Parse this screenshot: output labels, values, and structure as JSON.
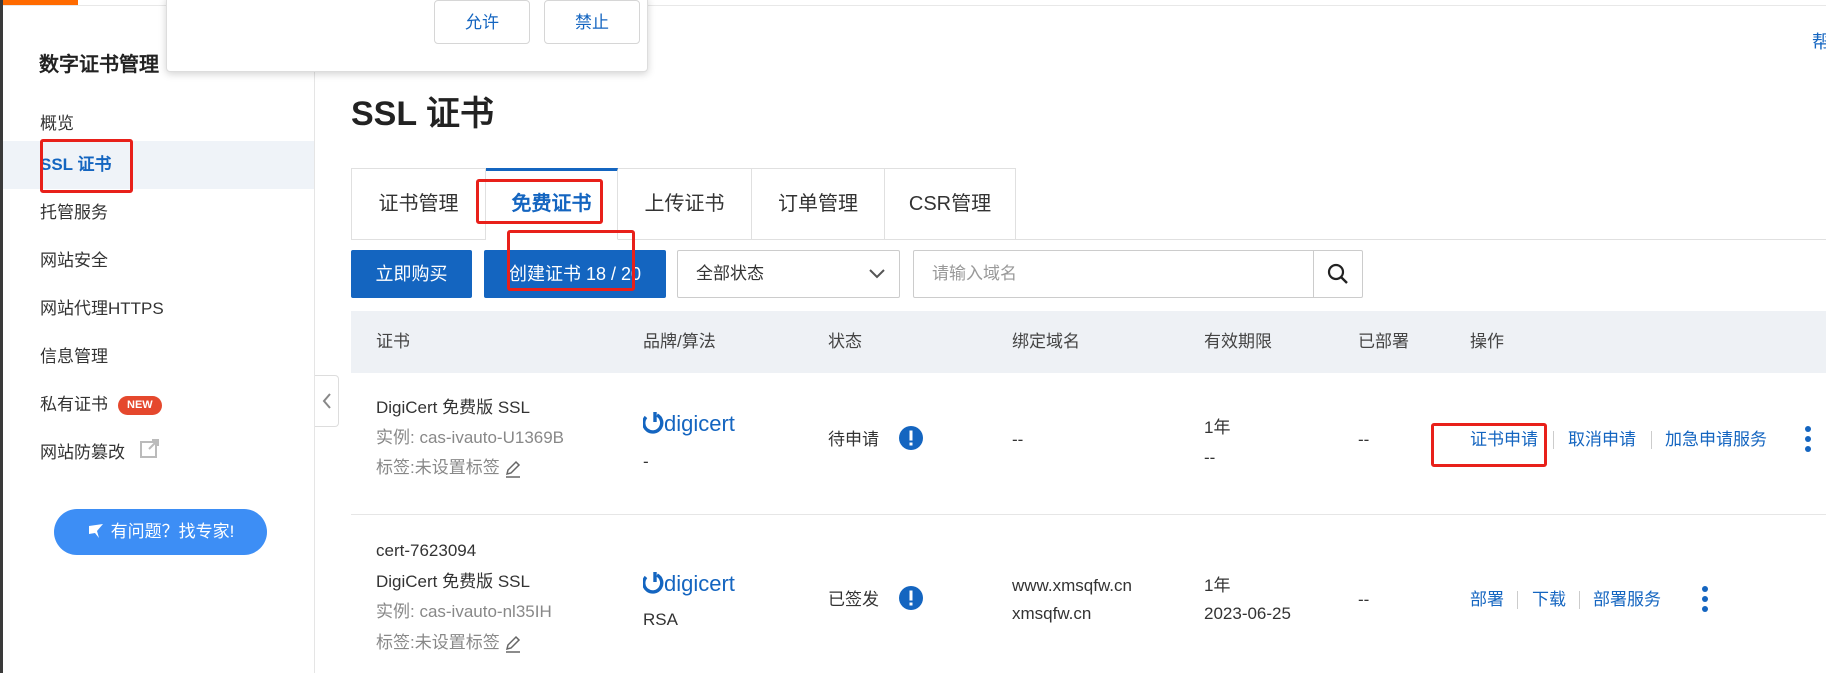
{
  "popup": {
    "allow_label": "允许",
    "deny_label": "禁止"
  },
  "help_corner": "帮",
  "sidebar": {
    "title": "数字证书管理",
    "items": [
      {
        "label": "概览"
      },
      {
        "label": "SSL 证书"
      },
      {
        "label": "托管服务"
      },
      {
        "label": "网站安全"
      },
      {
        "label": "网站代理HTTPS"
      },
      {
        "label": "信息管理"
      },
      {
        "label": "私有证书",
        "badge": "NEW"
      },
      {
        "label": "网站防篡改"
      }
    ],
    "help_button": "有问题？找专家!"
  },
  "page_title": "SSL 证书",
  "tabs": [
    {
      "label": "证书管理"
    },
    {
      "label": "免费证书"
    },
    {
      "label": "上传证书"
    },
    {
      "label": "订单管理"
    },
    {
      "label": "CSR管理"
    }
  ],
  "toolbar": {
    "buy_label": "立即购买",
    "create_label": "创建证书 18 / 20",
    "status_select": "全部状态",
    "search_placeholder": "请输入域名"
  },
  "table": {
    "headers": [
      "证书",
      "品牌/算法",
      "状态",
      "绑定域名",
      "有效期限",
      "已部署",
      "操作"
    ],
    "rows": [
      {
        "cert_lines": [
          "DigiCert 免费版 SSL"
        ],
        "instance": "实例: cas-ivauto-U1369B",
        "tag": "标签:未设置标签",
        "brand": "digicert",
        "algo": "-",
        "status": "待申请",
        "domains": [
          "--"
        ],
        "validity": [
          "1年",
          "--"
        ],
        "deployed": "--",
        "actions": [
          "证书申请",
          "取消申请",
          "加急申请服务"
        ]
      },
      {
        "cert_lines": [
          "cert-7623094",
          "DigiCert 免费版 SSL"
        ],
        "instance": "实例: cas-ivauto-nl35IH",
        "tag": "标签:未设置标签",
        "brand": "digicert",
        "algo": "RSA",
        "status": "已签发",
        "domains": [
          "www.xmsqfw.cn",
          "xmsqfw.cn"
        ],
        "validity": [
          "1年",
          "2023-06-25"
        ],
        "deployed": "--",
        "actions": [
          "部署",
          "下载",
          "部署服务"
        ]
      }
    ]
  },
  "colors": {
    "primary": "#1465c0",
    "highlight": "#e8201a",
    "badge_new": "#e5482d",
    "help_button": "#3d8ef5"
  }
}
